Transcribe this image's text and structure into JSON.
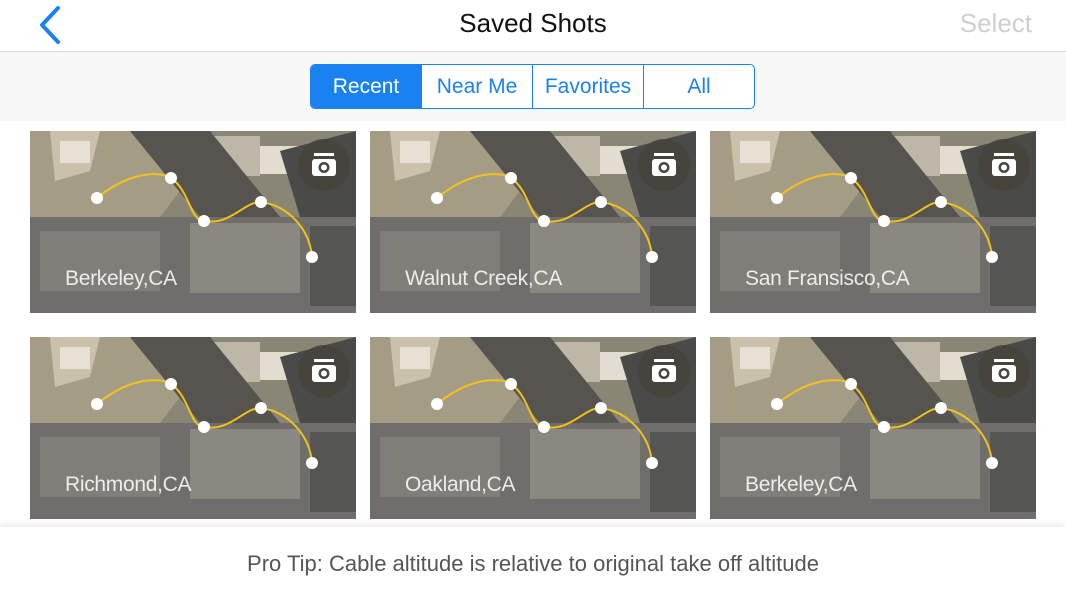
{
  "navbar": {
    "title": "Saved Shots",
    "select_label": "Select",
    "back_icon": "chevron-left-icon"
  },
  "segments": [
    {
      "label": "Recent",
      "active": true
    },
    {
      "label": "Near Me",
      "active": false
    },
    {
      "label": "Favorites",
      "active": false
    },
    {
      "label": "All",
      "active": false
    }
  ],
  "shots": [
    {
      "location": "Berkeley,CA"
    },
    {
      "location": "Walnut Creek,CA"
    },
    {
      "location": "San Fransisco,CA"
    },
    {
      "location": "Richmond,CA"
    },
    {
      "location": "Oakland,CA"
    },
    {
      "location": "Berkeley,CA"
    }
  ],
  "card_icon": "camera-icon",
  "tip": "Pro Tip: Cable altitude is relative to original take off altitude",
  "colors": {
    "accent": "#1a82f0",
    "path": "#f2c21b",
    "select_disabled": "#cfcfcf"
  }
}
